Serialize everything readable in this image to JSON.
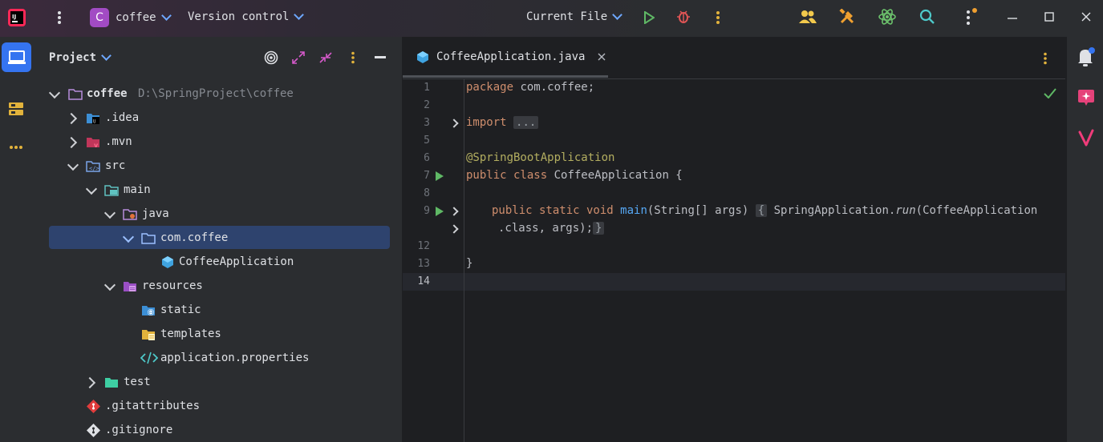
{
  "titlebar": {
    "project_badge": "C",
    "project_name": "coffee",
    "vcs_label": "Version control",
    "run_config": "Current File",
    "window_controls": [
      "minimize-icon",
      "maximize-icon",
      "close-icon"
    ]
  },
  "project_panel": {
    "title": "Project",
    "tree": [
      {
        "label": "coffee",
        "path": "D:\\SpringProject\\coffee",
        "icon": "module-folder-icon"
      },
      {
        "label": ".idea",
        "icon": "idea-folder-icon"
      },
      {
        "label": ".mvn",
        "icon": "maven-folder-icon"
      },
      {
        "label": "src",
        "icon": "source-folder-icon"
      },
      {
        "label": "main",
        "icon": "main-folder-icon"
      },
      {
        "label": "java",
        "icon": "java-folder-icon"
      },
      {
        "label": "com.coffee",
        "icon": "package-icon",
        "selected": true
      },
      {
        "label": "CoffeeApplication",
        "icon": "spring-class-icon"
      },
      {
        "label": "resources",
        "icon": "resources-folder-icon"
      },
      {
        "label": "static",
        "icon": "web-folder-icon"
      },
      {
        "label": "templates",
        "icon": "templates-folder-icon"
      },
      {
        "label": "application.properties",
        "icon": "properties-file-icon"
      },
      {
        "label": "test",
        "icon": "test-folder-icon"
      },
      {
        "label": ".gitattributes",
        "icon": "git-file-icon"
      },
      {
        "label": ".gitignore",
        "icon": "git-file-icon"
      }
    ]
  },
  "editor": {
    "tab_label": "CoffeeApplication.java",
    "line_numbers": [
      "1",
      "2",
      "3",
      "5",
      "6",
      "7",
      "8",
      "9",
      "12",
      "13",
      "14"
    ],
    "code": {
      "l1_kw": "package",
      "l1_rest": " com.coffee;",
      "l3_kw": "import",
      "l3_fold": "...",
      "l6": "@SpringBootApplication",
      "l7_kw": "public class",
      "l7_rest": " CoffeeApplication {",
      "l9_kw": "public static void",
      "l9_fn": "main",
      "l9_rest": "(String[] args)",
      "l9_fold": "{",
      "l9_call": " SpringApplication.",
      "l9_run": "run",
      "l9_tail": "(CoffeeApplication",
      "l9b_pre": ".class, args);",
      "l9b_fold": "}",
      "l13": "}"
    }
  },
  "colors": {
    "accent": "#3574f0",
    "selection": "#2e436e",
    "keyword": "#cf8e6d",
    "annotation": "#b3ae60",
    "function": "#56a8f5",
    "run_green": "#5fb865"
  }
}
